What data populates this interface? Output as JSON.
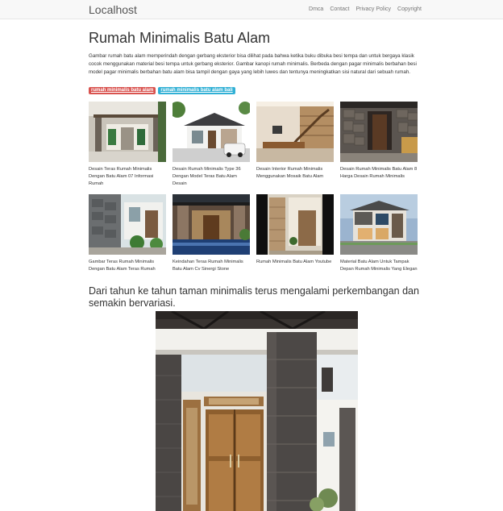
{
  "navbar": {
    "brand": "Localhost",
    "links": [
      "Dmca",
      "Contact",
      "Privacy Policy",
      "Copyright"
    ]
  },
  "article": {
    "title": "Rumah Minimalis Batu Alam",
    "description": "Gambar rumah batu alam memperindah dengan gerbang eksterior bisa dilihat pada bahwa ketika buku dibuka besi tempa dan untuk bergaya klasik cocok menggunakan material besi tempa untuk gerbang eksterior. Gambar kanopi rumah minimalis. Berbeda dengan pagar minimalis berbahan besi model pagar minimalis berbahan batu alam bisa tampil dengan gaya yang lebih luwes dan tentunya meningkatkan sisi natural dari sebuah rumah.",
    "tags": [
      "rumah minimalis batu alam",
      "rumah minimalis batu alam bali"
    ],
    "gallery": [
      "Desain Teras Rumah Minimalis Dengan Batu Alam 07 Informasi Rumah",
      "Desain Rumah Minimalis Type 36 Dengan Model Teras Batu Alam Desain",
      "Desain Interior Rumah Minimalis Menggunakan Mosaik Batu Alam",
      "Desain Rumah Minimalis Batu Alam 8 Harga Desain Rumah Minimalis",
      "Gambar Teras Rumah Minimalis Dengan Batu Alam Teras Rumah",
      "Keindahan Teras Rumah Minimalis Batu Alam Cv Sinergi Stone",
      "Rumah Minimalis Batu Alam Youtube",
      "Material Batu Alam Untuk Tampak Depan Rumah Minimalis Yang Elegan"
    ],
    "subheading": "Dari tahun ke tahun taman minimalis terus mengalami perkembangan dan semakin bervariasi."
  },
  "colors": {
    "tag_red": "#d9534f",
    "tag_teal": "#31b0d5",
    "navbar_bg": "#f8f8f8"
  }
}
